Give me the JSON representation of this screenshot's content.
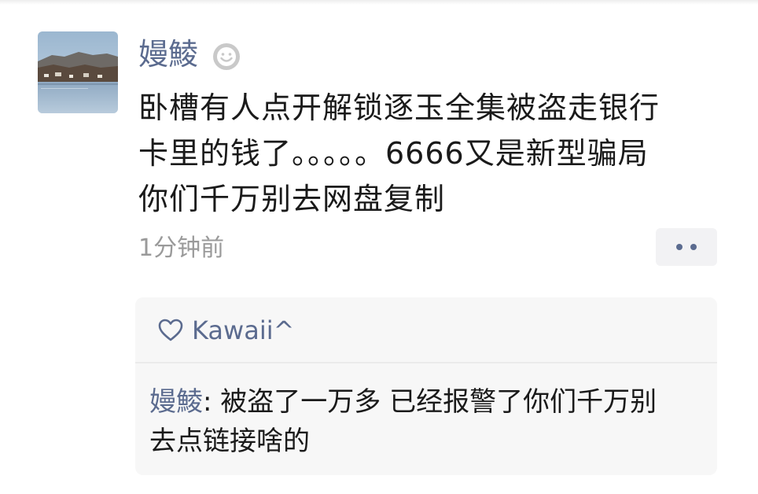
{
  "post": {
    "username": "嫚鯪",
    "status_icon": "smiley-face-icon",
    "text_lines": [
      "卧槽有人点开解锁逐玉全集被盗走银行",
      "卡里的钱了。。。。。6666又是新型骗局",
      "你们千万别去网盘复制"
    ],
    "timestamp": "1分钟前",
    "more_icon": "more-dots-icon"
  },
  "likes": {
    "icon": "heart-outline-icon",
    "names": "Kawaii^"
  },
  "comment": {
    "author": "嫚鯪",
    "separator": ": ",
    "text_line1": "被盗了一万多 已经报警了你们千万别",
    "text_line2": "去点链接啥的"
  },
  "colors": {
    "name_link": "#5b6b8f",
    "timestamp": "#9a9a9a",
    "panel_bg": "#f7f7f7",
    "body_text": "#1a1a1a"
  }
}
